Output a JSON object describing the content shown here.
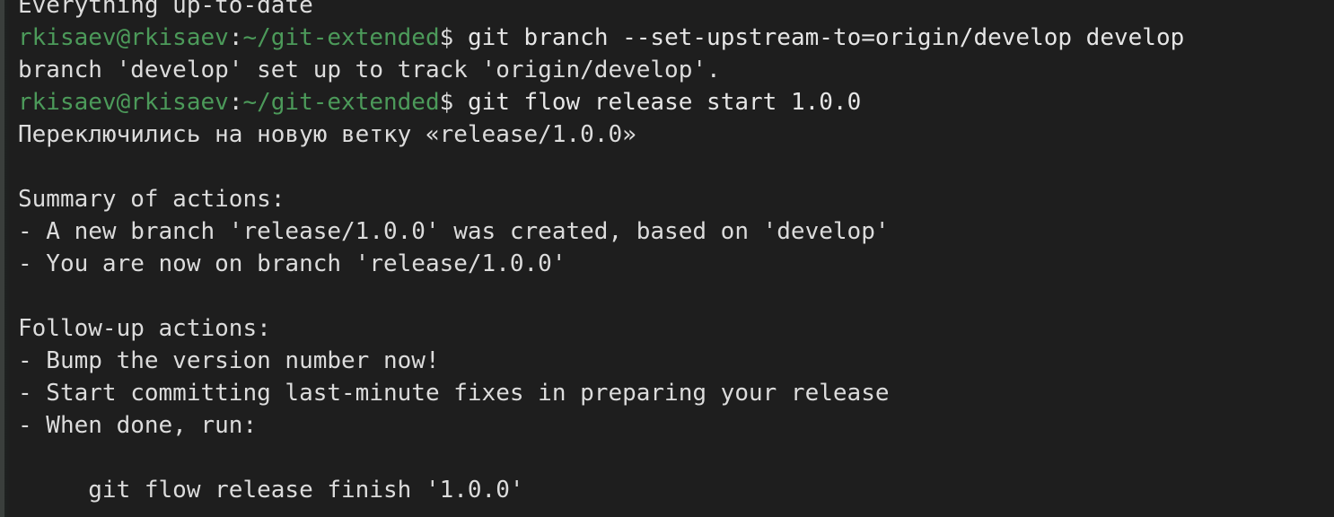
{
  "terminal": {
    "prompt": {
      "user_host": "rkisaev@rkisaev",
      "separator": ":",
      "path": "~/git-extended",
      "dollar": "$ "
    },
    "lines": [
      {
        "type": "output",
        "text": "Everything up-to-date"
      },
      {
        "type": "prompt",
        "command": "git branch --set-upstream-to=origin/develop develop"
      },
      {
        "type": "output",
        "text": "branch 'develop' set up to track 'origin/develop'."
      },
      {
        "type": "prompt",
        "command": "git flow release start 1.0.0"
      },
      {
        "type": "output",
        "text": "Переключились на новую ветку «release/1.0.0»"
      },
      {
        "type": "output",
        "text": ""
      },
      {
        "type": "output",
        "text": "Summary of actions:"
      },
      {
        "type": "output",
        "text": "- A new branch 'release/1.0.0' was created, based on 'develop'"
      },
      {
        "type": "output",
        "text": "- You are now on branch 'release/1.0.0'"
      },
      {
        "type": "output",
        "text": ""
      },
      {
        "type": "output",
        "text": "Follow-up actions:"
      },
      {
        "type": "output",
        "text": "- Bump the version number now!"
      },
      {
        "type": "output",
        "text": "- Start committing last-minute fixes in preparing your release"
      },
      {
        "type": "output",
        "text": "- When done, run:"
      },
      {
        "type": "output",
        "text": ""
      },
      {
        "type": "output",
        "text": "     git flow release finish '1.0.0'"
      }
    ]
  },
  "colors": {
    "background": "#1e1e1e",
    "text": "#dcdcdc",
    "prompt_green": "#4c9a5a"
  }
}
